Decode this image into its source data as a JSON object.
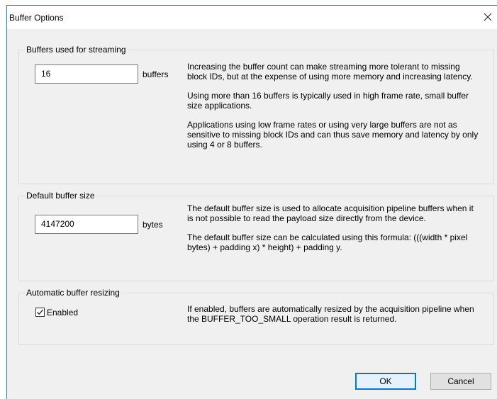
{
  "window": {
    "title": "Buffer Options",
    "close_glyph": "✕"
  },
  "streaming": {
    "legend": "Buffers used for streaming",
    "value": "16",
    "unit": "buffers",
    "desc": [
      "Increasing the buffer count can make streaming more tolerant to missing block IDs, but at the expense of using more memory and increasing latency.",
      "Using more than 16 buffers is typically used in high frame rate, small buffer size applications.",
      "Applications using low frame rates or using very large buffers are not as sensitive to missing block IDs and can thus save memory and latency by only using 4 or 8 buffers."
    ]
  },
  "default_size": {
    "legend": "Default buffer size",
    "value": "4147200",
    "unit": "bytes",
    "desc": [
      "The default buffer size is used to allocate acquisition pipeline buffers when it is not possible to read the payload size directly from the device.",
      "The default buffer size can be calculated using this formula: (((width * pixel bytes) + padding x) * height) + padding y."
    ]
  },
  "resizing": {
    "legend": "Automatic buffer resizing",
    "checkbox_label": "Enabled",
    "checked": true,
    "desc": [
      "If enabled, buffers are automatically resized by the acquisition pipeline when the BUFFER_TOO_SMALL operation result is returned."
    ]
  },
  "buttons": {
    "ok": "OK",
    "cancel": "Cancel"
  },
  "colors": {
    "accent": "#0078d7",
    "window_border": "#1e7fd1",
    "dialog_bg": "#f0f0f0"
  }
}
